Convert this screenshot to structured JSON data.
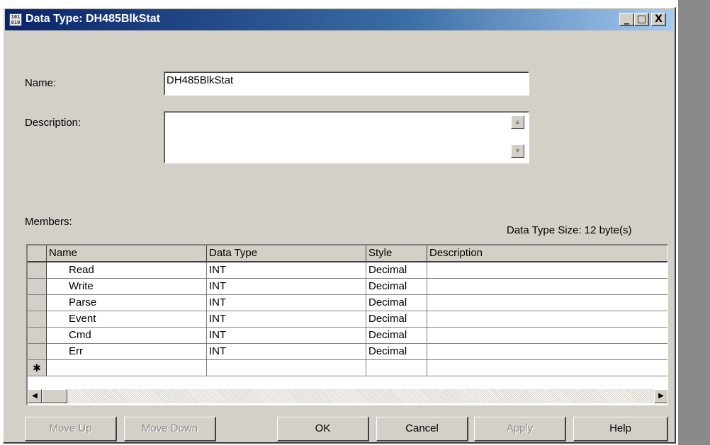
{
  "window": {
    "title": "Data Type:  DH485BlkStat",
    "icon": "data-type-icon",
    "minimize_glyph": "_",
    "maximize_glyph": "□",
    "close_glyph": "X"
  },
  "form": {
    "name_label": "Name:",
    "name_value": "DH485BlkStat",
    "description_label": "Description:",
    "description_value": "",
    "members_label": "Members:",
    "size_text": "Data Type Size: 12 byte(s)"
  },
  "grid": {
    "columns": [
      "Name",
      "Data Type",
      "Style",
      "Description"
    ],
    "rows": [
      {
        "name": "Read",
        "data_type": "INT",
        "style": "Decimal",
        "description": ""
      },
      {
        "name": "Write",
        "data_type": "INT",
        "style": "Decimal",
        "description": ""
      },
      {
        "name": "Parse",
        "data_type": "INT",
        "style": "Decimal",
        "description": ""
      },
      {
        "name": "Event",
        "data_type": "INT",
        "style": "Decimal",
        "description": ""
      },
      {
        "name": "Cmd",
        "data_type": "INT",
        "style": "Decimal",
        "description": ""
      },
      {
        "name": "Err",
        "data_type": "INT",
        "style": "Decimal",
        "description": ""
      }
    ],
    "new_row_marker": "✱"
  },
  "buttons": {
    "move_up": "Move Up",
    "move_down": "Move Down",
    "ok": "OK",
    "cancel": "Cancel",
    "apply": "Apply",
    "help": "Help"
  },
  "colors": {
    "title_start": "#0a246a",
    "title_end": "#a6caf0",
    "dialog_bg": "#d4d0c8"
  }
}
